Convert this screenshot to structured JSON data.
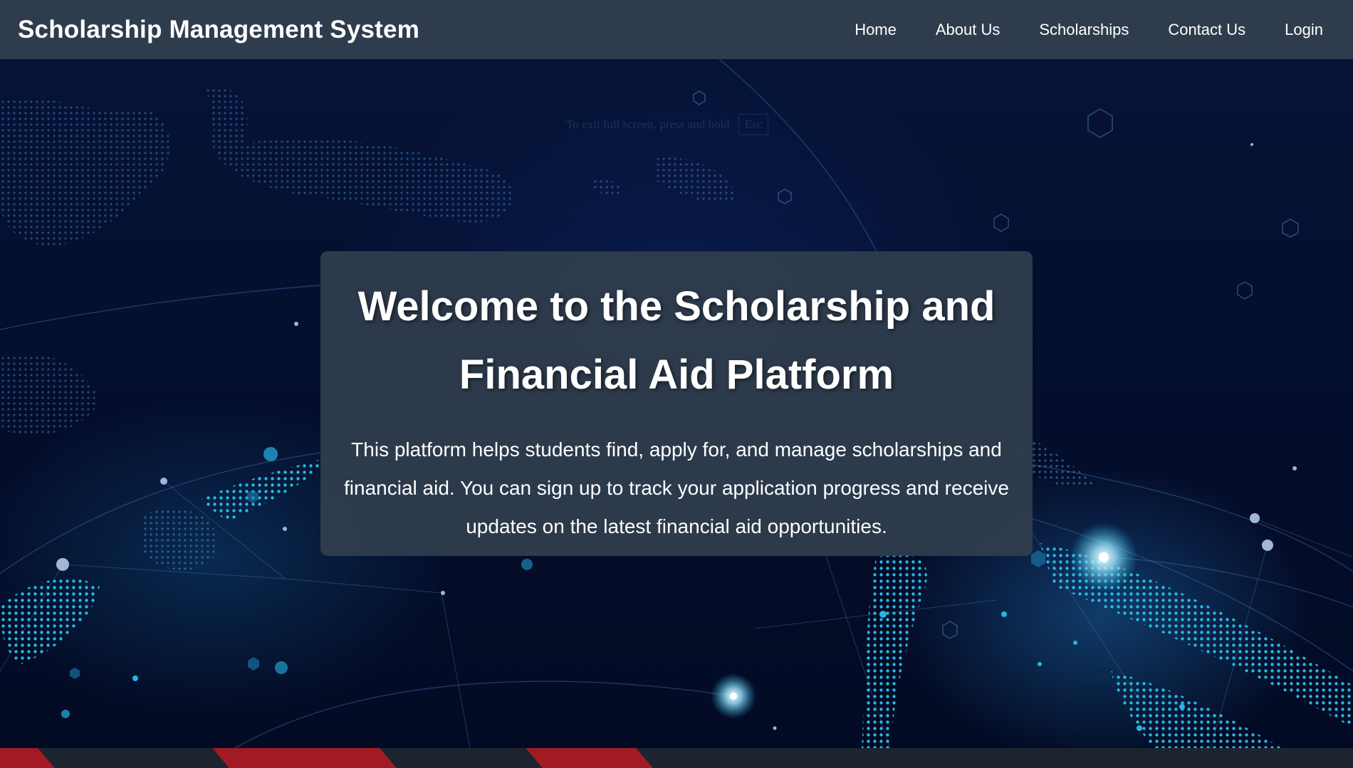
{
  "navbar": {
    "brand": "Scholarship Management System",
    "links": [
      {
        "label": "Home"
      },
      {
        "label": "About Us"
      },
      {
        "label": "Scholarships"
      },
      {
        "label": "Contact Us"
      },
      {
        "label": "Login"
      }
    ]
  },
  "overlay": {
    "fullscreen_hint": "To exit full screen, press and hold",
    "key": "Esc"
  },
  "hero": {
    "title": "Welcome to the Scholarship and Financial Aid Platform",
    "description": "This platform helps students find, apply for, and manage scholarships and financial aid. You can sign up to track your application progress and receive updates on the latest financial aid opportunities."
  },
  "colors": {
    "navbar_bg": "#2f3c4d",
    "card_bg": "#2f3c4d",
    "hero_bg": "#041032",
    "accent_cyan": "#1fb8e8",
    "footer_stripe": "#a11a24"
  }
}
